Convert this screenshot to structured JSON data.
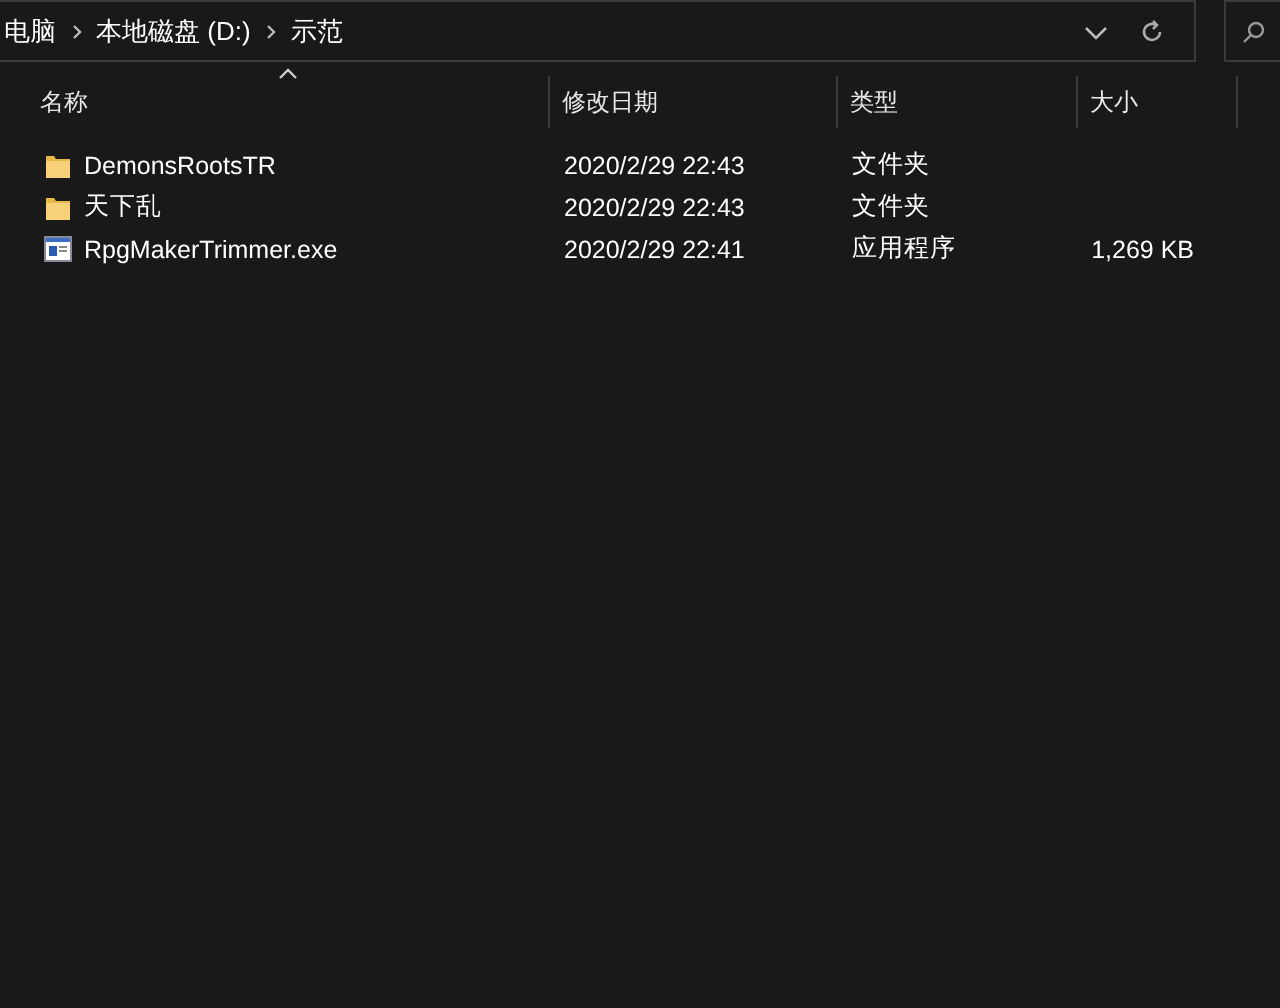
{
  "address_bar": {
    "breadcrumbs": [
      "电脑",
      "本地磁盘 (D:)",
      "示范"
    ]
  },
  "table": {
    "columns": [
      {
        "label": "名称",
        "sorted": true
      },
      {
        "label": "修改日期",
        "sorted": false
      },
      {
        "label": "类型",
        "sorted": false
      },
      {
        "label": "大小",
        "sorted": false
      }
    ],
    "rows": [
      {
        "kind": "folder",
        "name": "DemonsRootsTR",
        "modified": "2020/2/29 22:43",
        "type": "文件夹"
      },
      {
        "kind": "folder",
        "name": "天下乱",
        "modified": "2020/2/29 22:43",
        "type": "文件夹"
      },
      {
        "kind": "exe",
        "name": "RpgMakerTrimmer.exe",
        "modified": "2020/2/29 22:41",
        "type": "应用程序",
        "size": "1,269 KB"
      }
    ]
  }
}
